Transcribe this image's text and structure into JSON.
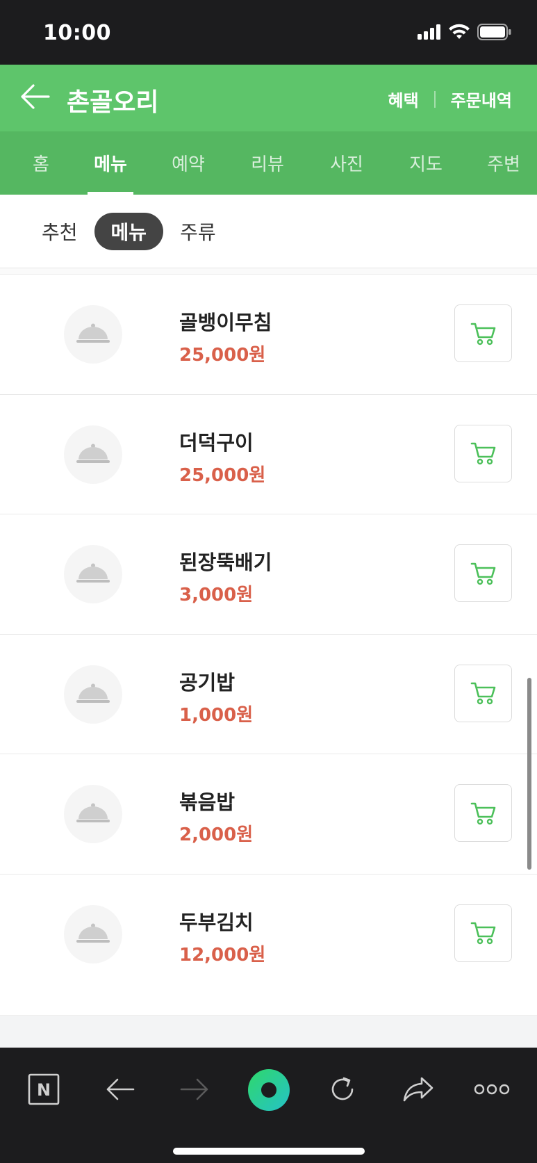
{
  "status_bar": {
    "time": "10:00"
  },
  "header": {
    "title": "촌골오리",
    "benefit_label": "혜택",
    "orders_label": "주문내역"
  },
  "tabs": [
    {
      "label": "홈",
      "active": false
    },
    {
      "label": "메뉴",
      "active": true
    },
    {
      "label": "예약",
      "active": false
    },
    {
      "label": "리뷰",
      "active": false
    },
    {
      "label": "사진",
      "active": false
    },
    {
      "label": "지도",
      "active": false
    },
    {
      "label": "주변",
      "active": false
    }
  ],
  "subtabs": [
    {
      "label": "추천",
      "active": false
    },
    {
      "label": "메뉴",
      "active": true
    },
    {
      "label": "주류",
      "active": false
    }
  ],
  "menu_items": [
    {
      "name": "골뱅이무침",
      "price": "25,000원"
    },
    {
      "name": "더덕구이",
      "price": "25,000원"
    },
    {
      "name": "된장뚝배기",
      "price": "3,000원"
    },
    {
      "name": "공기밥",
      "price": "1,000원"
    },
    {
      "name": "볶음밥",
      "price": "2,000원"
    },
    {
      "name": "두부김치",
      "price": "12,000원"
    }
  ],
  "browser_bar": {
    "naver_label": "N"
  },
  "colors": {
    "header_green": "#5ec56b",
    "tab_green": "#55b761",
    "price_red": "#d9604a",
    "cart_green": "#4cc05a"
  }
}
